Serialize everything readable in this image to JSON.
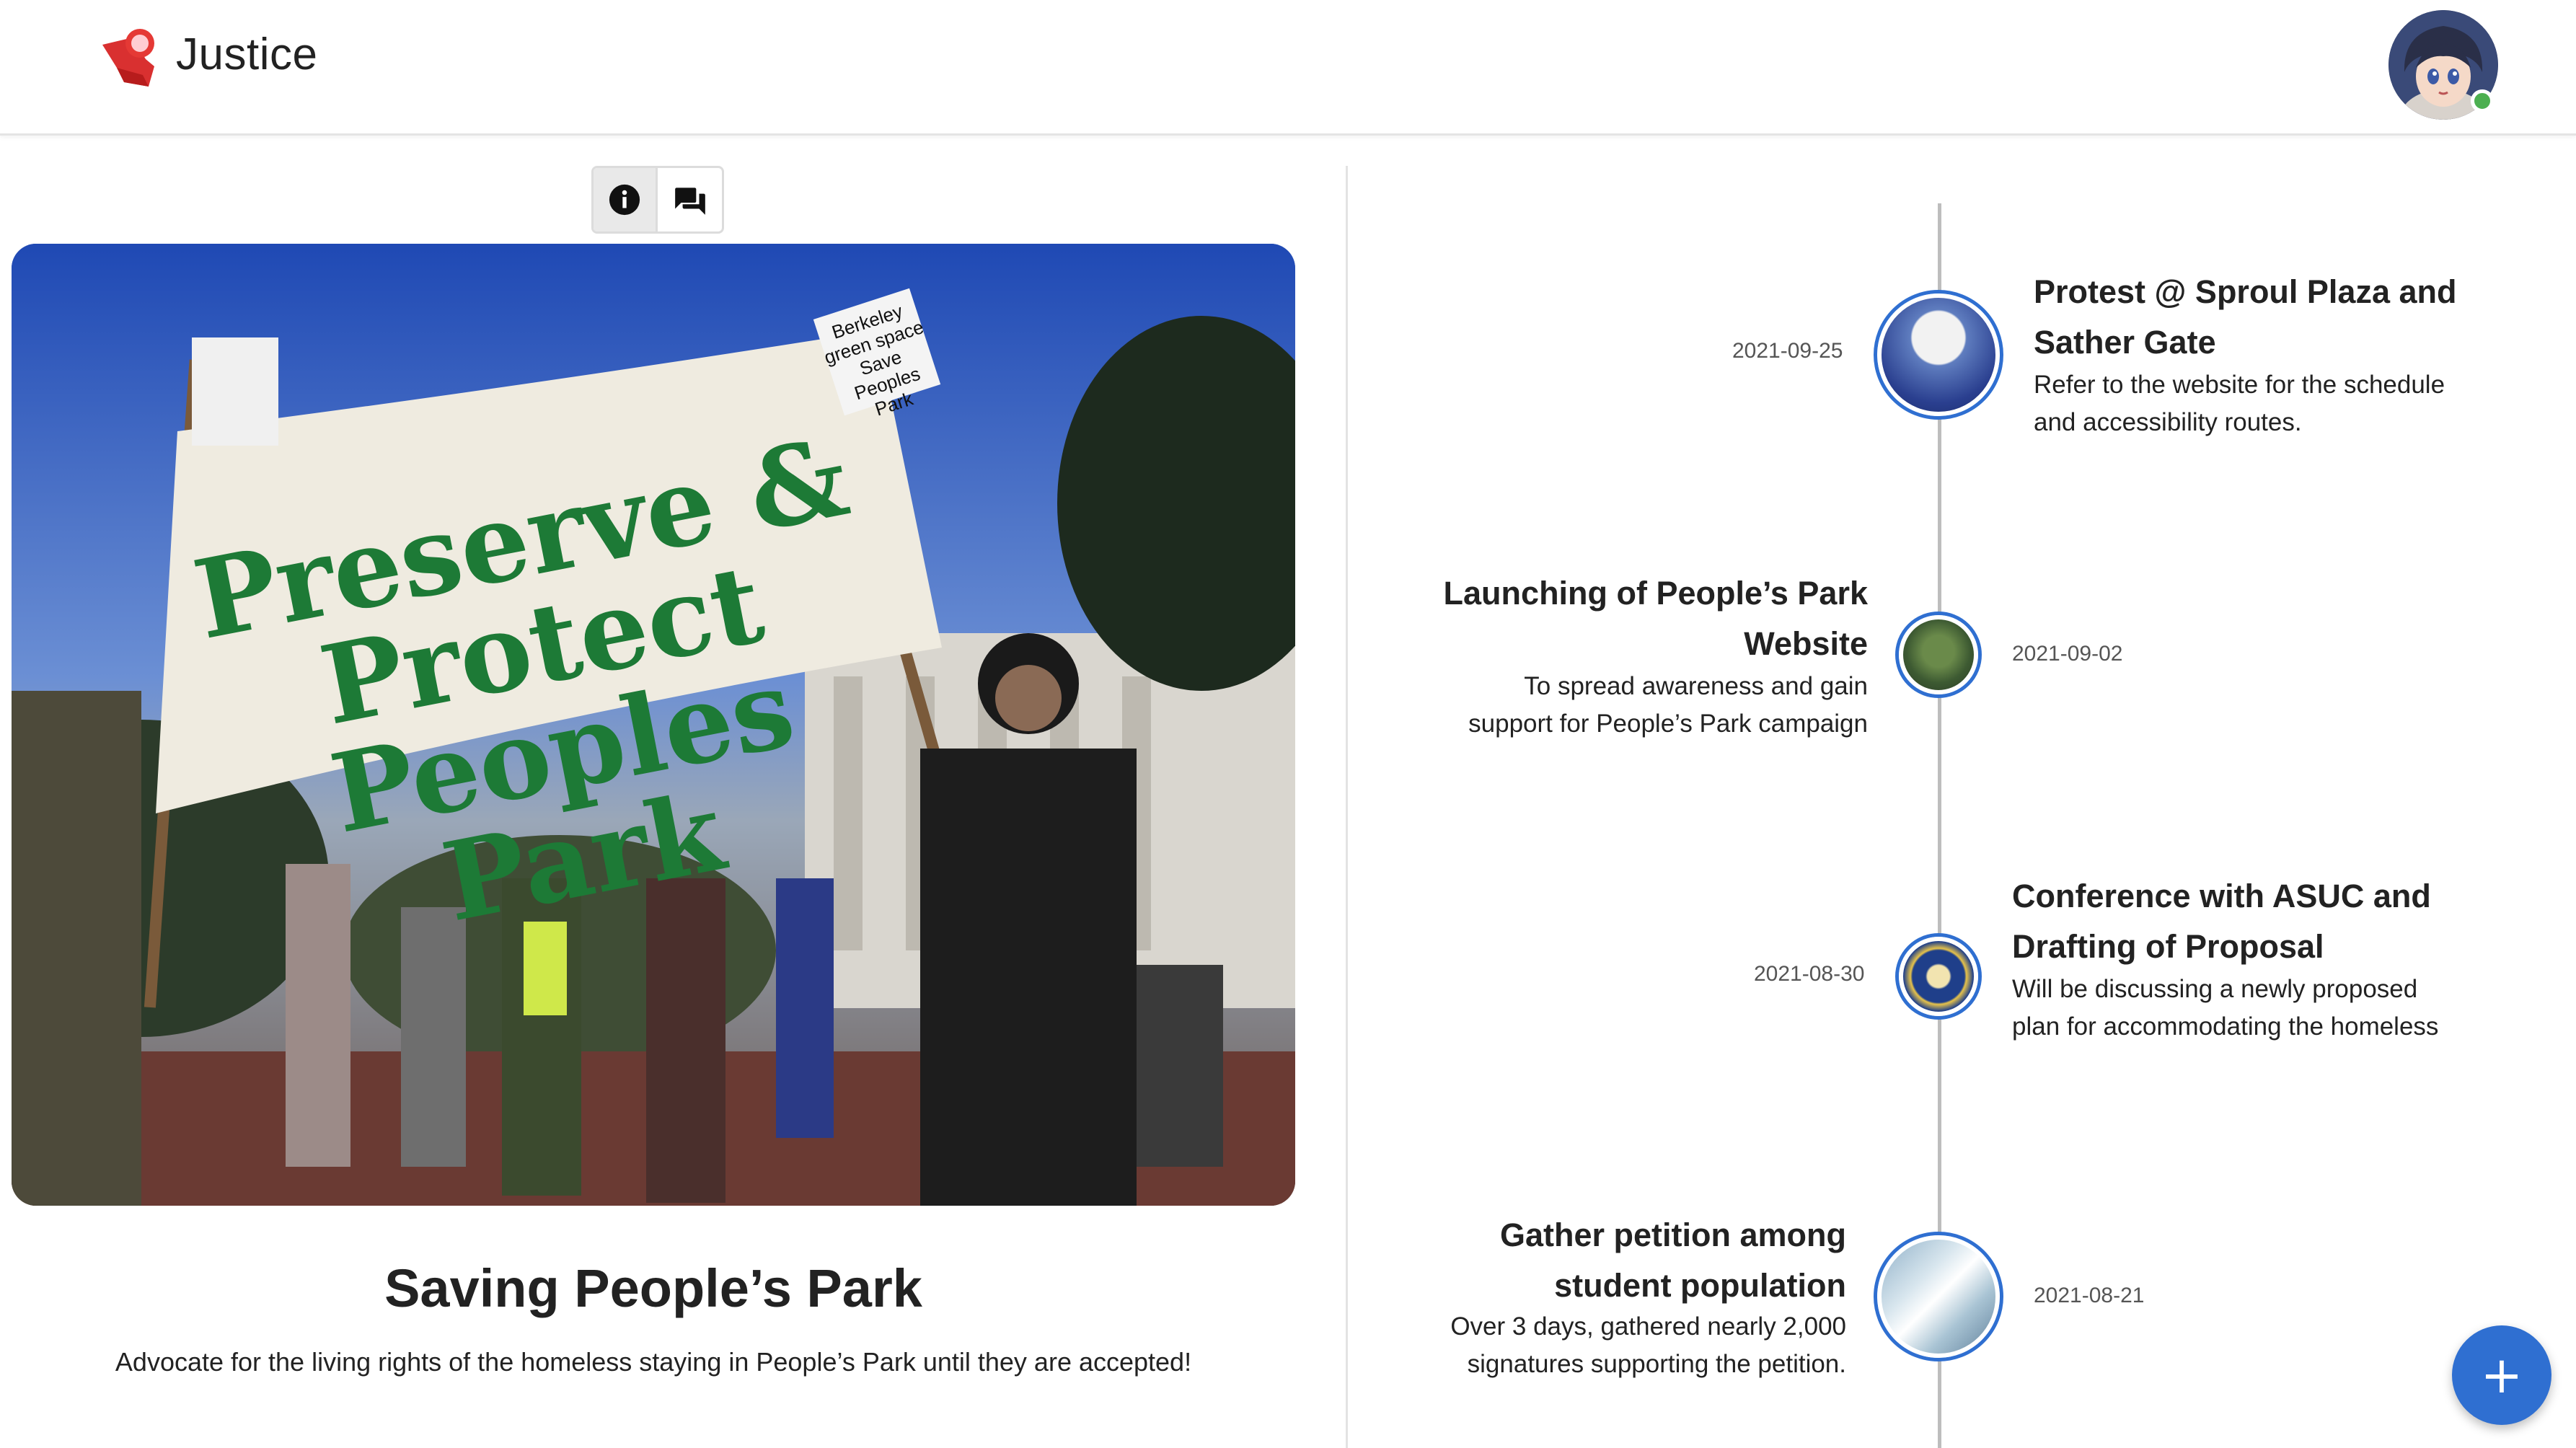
{
  "app": {
    "title": "Justice"
  },
  "toggle": {
    "info_icon": "info-icon",
    "chat_icon": "chat-icon"
  },
  "campaign": {
    "banner_text_1": "Preserve & Protect",
    "banner_text_2": "Peoples Park",
    "sign_text_1": "Berkeley green space",
    "sign_text_2": "Save Peoples Park",
    "title": "Saving People’s Park",
    "description": "Advocate for the living rights of the homeless staying in People’s Park until they are accepted!"
  },
  "timeline": [
    {
      "date": "2021-09-25",
      "title": "Protest @ Sproul Plaza and Sather Gate",
      "description": "Refer to the website for the schedule and accessibility routes."
    },
    {
      "date": "2021-09-02",
      "title": "Launching of People’s Park Website",
      "description": "To spread awareness and gain support for People’s Park campaign"
    },
    {
      "date": "2021-08-30",
      "title": "Conference with ASUC and Drafting of Proposal",
      "description": "Will be discussing a newly proposed plan for accommodating the homeless"
    },
    {
      "date": "2021-08-21",
      "title": "Gather petition among student population",
      "description": "Over 3 days, gathered nearly 2,000 signatures supporting the petition."
    }
  ],
  "fab": {
    "label": "+"
  },
  "colors": {
    "accent": "#2f6fd1",
    "online": "#4caf50",
    "logo": "#e53935"
  }
}
